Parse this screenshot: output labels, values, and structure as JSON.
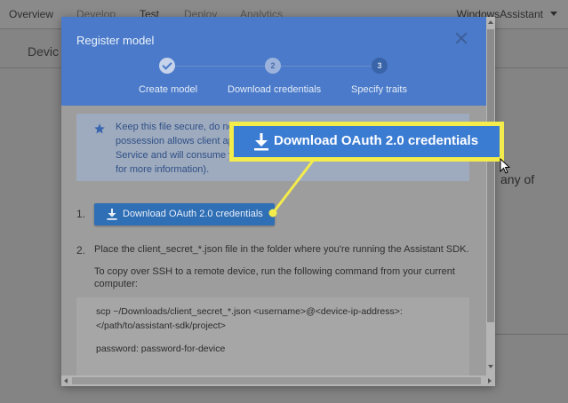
{
  "nav": {
    "items": [
      "Overview",
      "Develop",
      "Test",
      "Deploy",
      "Analytics"
    ],
    "account": "WindowsAssistant"
  },
  "background": {
    "card_title": "Devic",
    "side_text": "any of"
  },
  "dialog": {
    "title": "Register model",
    "steps": [
      {
        "number": "",
        "label": "Create model",
        "state": "done"
      },
      {
        "number": "2",
        "label": "Download credentials",
        "state": "active"
      },
      {
        "number": "3",
        "label": "Specify traits",
        "state": "current"
      }
    ],
    "info_lines": [
      "Keep this file secure, do not",
      "possession allows client ap",
      "Service and will consume y",
      "for more information)."
    ],
    "step1_number": "1.",
    "download_button_label": "Download OAuth 2.0 credentials",
    "step2_number": "2.",
    "step2_text": "Place the client_secret_*.json file in the folder where you're running the Assistant SDK.",
    "ssh_text_line1": "To copy over SSH to a remote device, run the following command from your current",
    "ssh_text_line2": "computer:",
    "code_lines": [
      "scp ~/Downloads/client_secret_*.json <username>@<device-ip-address>:",
      "</path/to/assistant-sdk/project>",
      "password: password-for-device"
    ]
  },
  "callout": {
    "label": "Download OAuth 2.0 credentials"
  },
  "colors": {
    "dialog_header": "#4a7ac9",
    "callout_border": "#f4ec4a",
    "callout_fill": "#3b7cd3",
    "button_fill": "#2f6fb5"
  }
}
